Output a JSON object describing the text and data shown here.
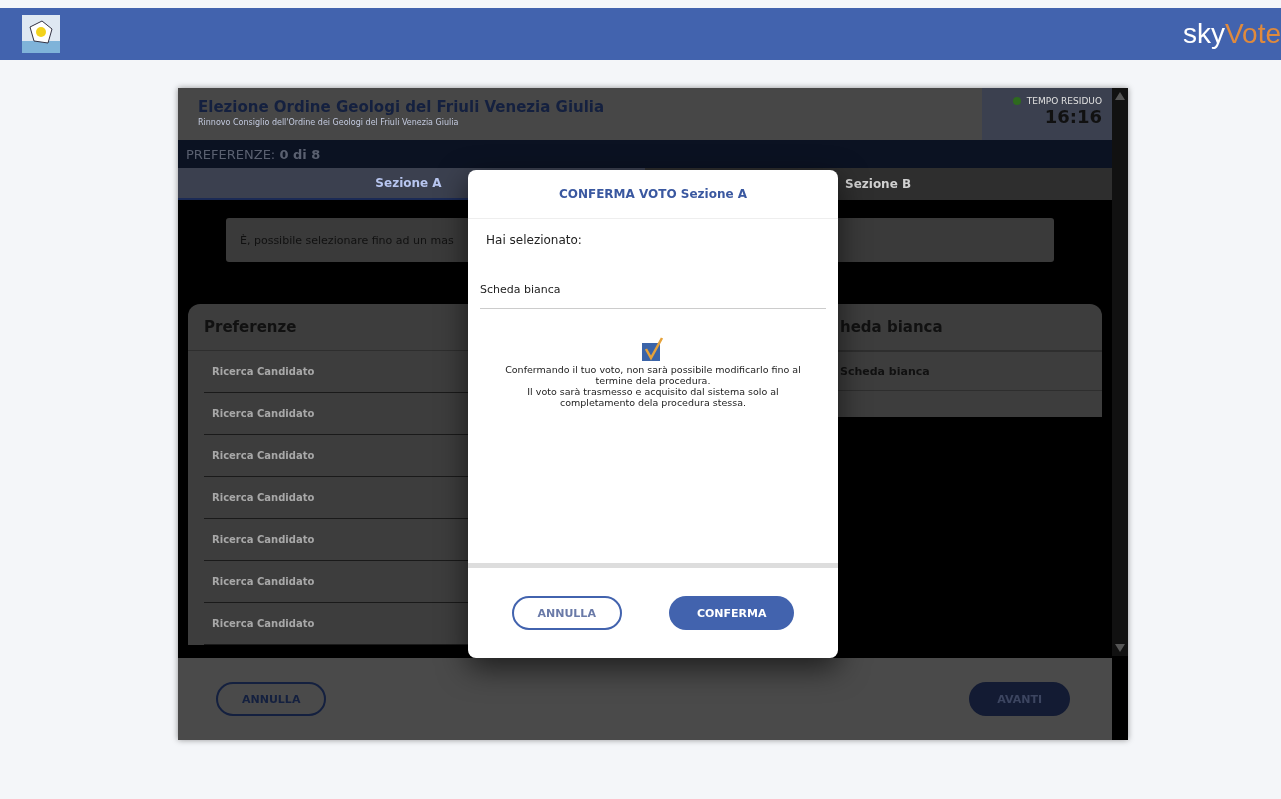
{
  "top_bar": {
    "brand": {
      "first": "sky",
      "second": "Vote"
    }
  },
  "election": {
    "title": "Elezione Ordine Geologi del Friuli Venezia Giulia",
    "subtitle": "Rinnovo Consiglio dell'Ordine dei Geologi del Friuli Venezia Giulia"
  },
  "timer": {
    "label": "TEMPO RESIDUO",
    "value": "16:16"
  },
  "preferences_bar": "PREFERENZE: **0 di 8**",
  "tabs": [
    {
      "label": "Sezione A",
      "selected": true
    },
    {
      "label": "Sezione B",
      "selected": false
    }
  ],
  "info": "È, possibile selezionare fino ad un mas",
  "preferences_panel": {
    "title": "Preferenze",
    "fields": [
      {
        "placeholder": "Ricerca Candidato"
      },
      {
        "placeholder": "Ricerca Candidato"
      },
      {
        "placeholder": "Ricerca Candidato"
      },
      {
        "placeholder": "Ricerca Candidato"
      },
      {
        "placeholder": "Ricerca Candidato"
      },
      {
        "placeholder": "Ricerca Candidato"
      },
      {
        "placeholder": "Ricerca Candidato"
      }
    ]
  },
  "choice_panel": {
    "title": "heda bianca",
    "items": [
      "Scheda bianca"
    ]
  },
  "footer": {
    "cancel": "ANNULLA",
    "next": "AVANTI"
  },
  "dialog": {
    "title": "CONFERMA VOTO Sezione A",
    "lead": "Hai selezionato:",
    "selection": "Scheda bianca",
    "notes": [
      "Confermando il tuo voto, non sarà possibile modificarlo fino al termine dela procedura.",
      "Il voto sarà trasmesso e acquisito dal sistema solo al completamento dela procedura stessa."
    ],
    "cancel": "ANNULLA",
    "confirm": "CONFERMA"
  }
}
